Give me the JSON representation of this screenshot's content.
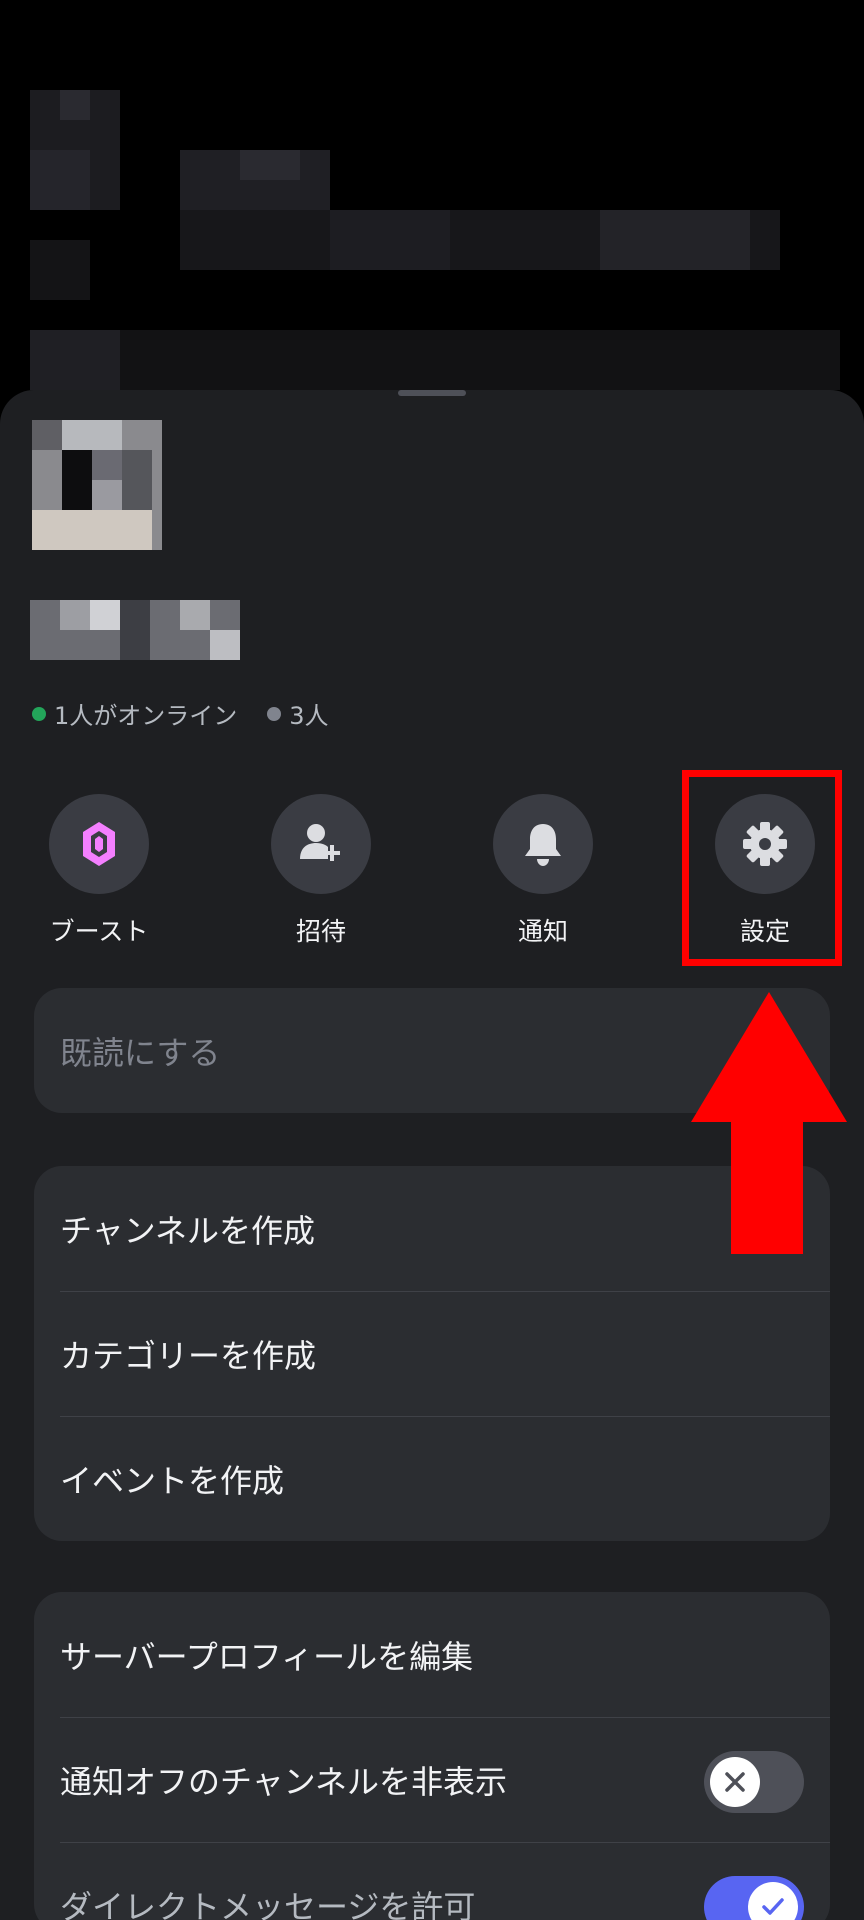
{
  "server": {
    "online_count_text": "1人がオンライン",
    "member_count_text": "3人"
  },
  "actions": [
    {
      "label": "ブースト",
      "icon": "boost-gem-icon",
      "color": "#f47fff"
    },
    {
      "label": "招待",
      "icon": "add-person-icon"
    },
    {
      "label": "通知",
      "icon": "bell-icon"
    },
    {
      "label": "設定",
      "icon": "gear-icon"
    }
  ],
  "menu": {
    "mark_read": "既読にする",
    "create_channel": "チャンネルを作成",
    "create_category": "カテゴリーを作成",
    "create_event": "イベントを作成",
    "edit_server_profile": "サーバープロフィールを編集",
    "hide_muted_channels": "通知オフのチャンネルを非表示",
    "allow_dms": "ダイレクトメッセージを許可"
  },
  "toggles": {
    "hide_muted_channels": false,
    "allow_dms": true
  },
  "colors": {
    "online": "#23a55a",
    "offline": "#80848e",
    "annotation": "#ff0000",
    "toggle_on": "#5865f2"
  }
}
